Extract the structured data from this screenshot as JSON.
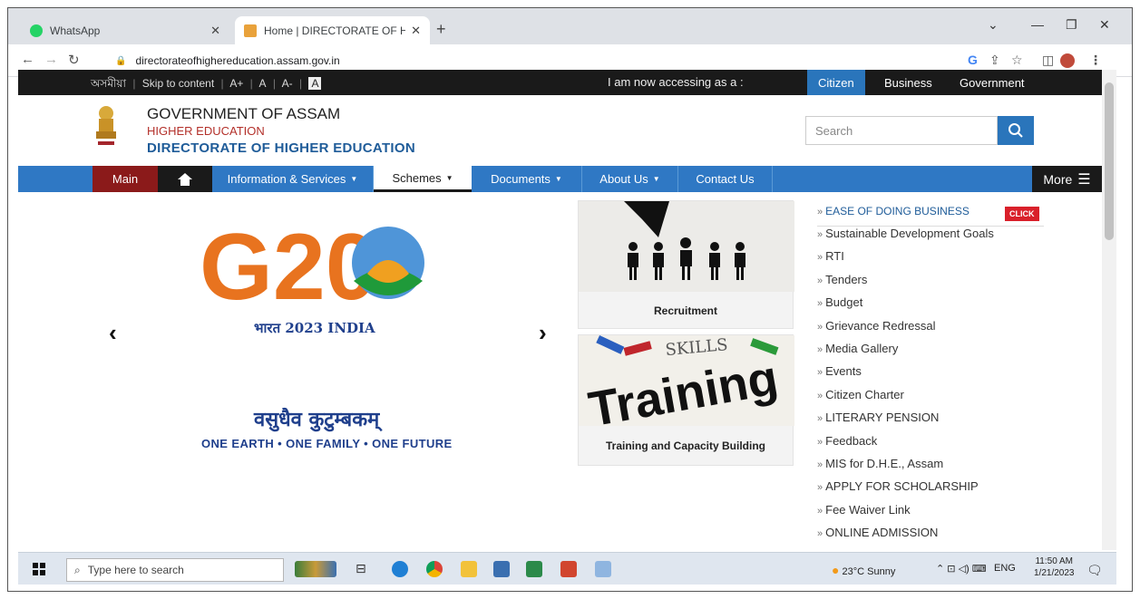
{
  "browser": {
    "tabs": [
      {
        "title": "WhatsApp",
        "active": false
      },
      {
        "title": "Home | DIRECTORATE OF HIGHE",
        "active": true
      }
    ],
    "url": "directorateofhighereducation.assam.gov.in"
  },
  "topbar": {
    "lang": "অসমীয়া",
    "skip": "Skip to content",
    "font_plus": "A+",
    "font_normal": "A",
    "font_minus": "A-",
    "contrast": "A",
    "accessing": "I am now accessing as a :",
    "roles": [
      "Citizen",
      "Business",
      "Government"
    ]
  },
  "header": {
    "line1": "GOVERNMENT OF ASSAM",
    "line2": "HIGHER EDUCATION",
    "line3": "DIRECTORATE OF HIGHER EDUCATION",
    "search_placeholder": "Search"
  },
  "nav": {
    "main": "Main",
    "items": [
      "Information & Services",
      "Schemes",
      "Documents",
      "About Us",
      "Contact Us"
    ],
    "more": "More"
  },
  "carousel": {
    "g20": "G20",
    "bharat": "भारत 2023 INDIA",
    "vasudhaiva": "वसुधैव कुटुम्बकम्",
    "tagline": "ONE EARTH • ONE FAMILY • ONE FUTURE",
    "prev": "‹",
    "next": "›"
  },
  "cards": [
    {
      "caption": "Recruitment"
    },
    {
      "caption": "Training and Capacity Building",
      "image_text": "Training",
      "banner": "SKILLS"
    }
  ],
  "quick_links": {
    "click_badge": "CLICK",
    "items": [
      "EASE OF DOING BUSINESS",
      "Sustainable Development Goals",
      "RTI",
      "Tenders",
      "Budget",
      "Grievance Redressal",
      "Media Gallery",
      "Events",
      "Citizen Charter",
      "LITERARY PENSION",
      "Feedback",
      "MIS for D.H.E., Assam",
      "APPLY FOR SCHOLARSHIP",
      "Fee Waiver Link",
      "ONLINE ADMISSION"
    ]
  },
  "taskbar": {
    "search_placeholder": "Type here to search",
    "weather": "23°C  Sunny",
    "lang": "ENG",
    "time": "11:50 AM",
    "date": "1/21/2023"
  }
}
